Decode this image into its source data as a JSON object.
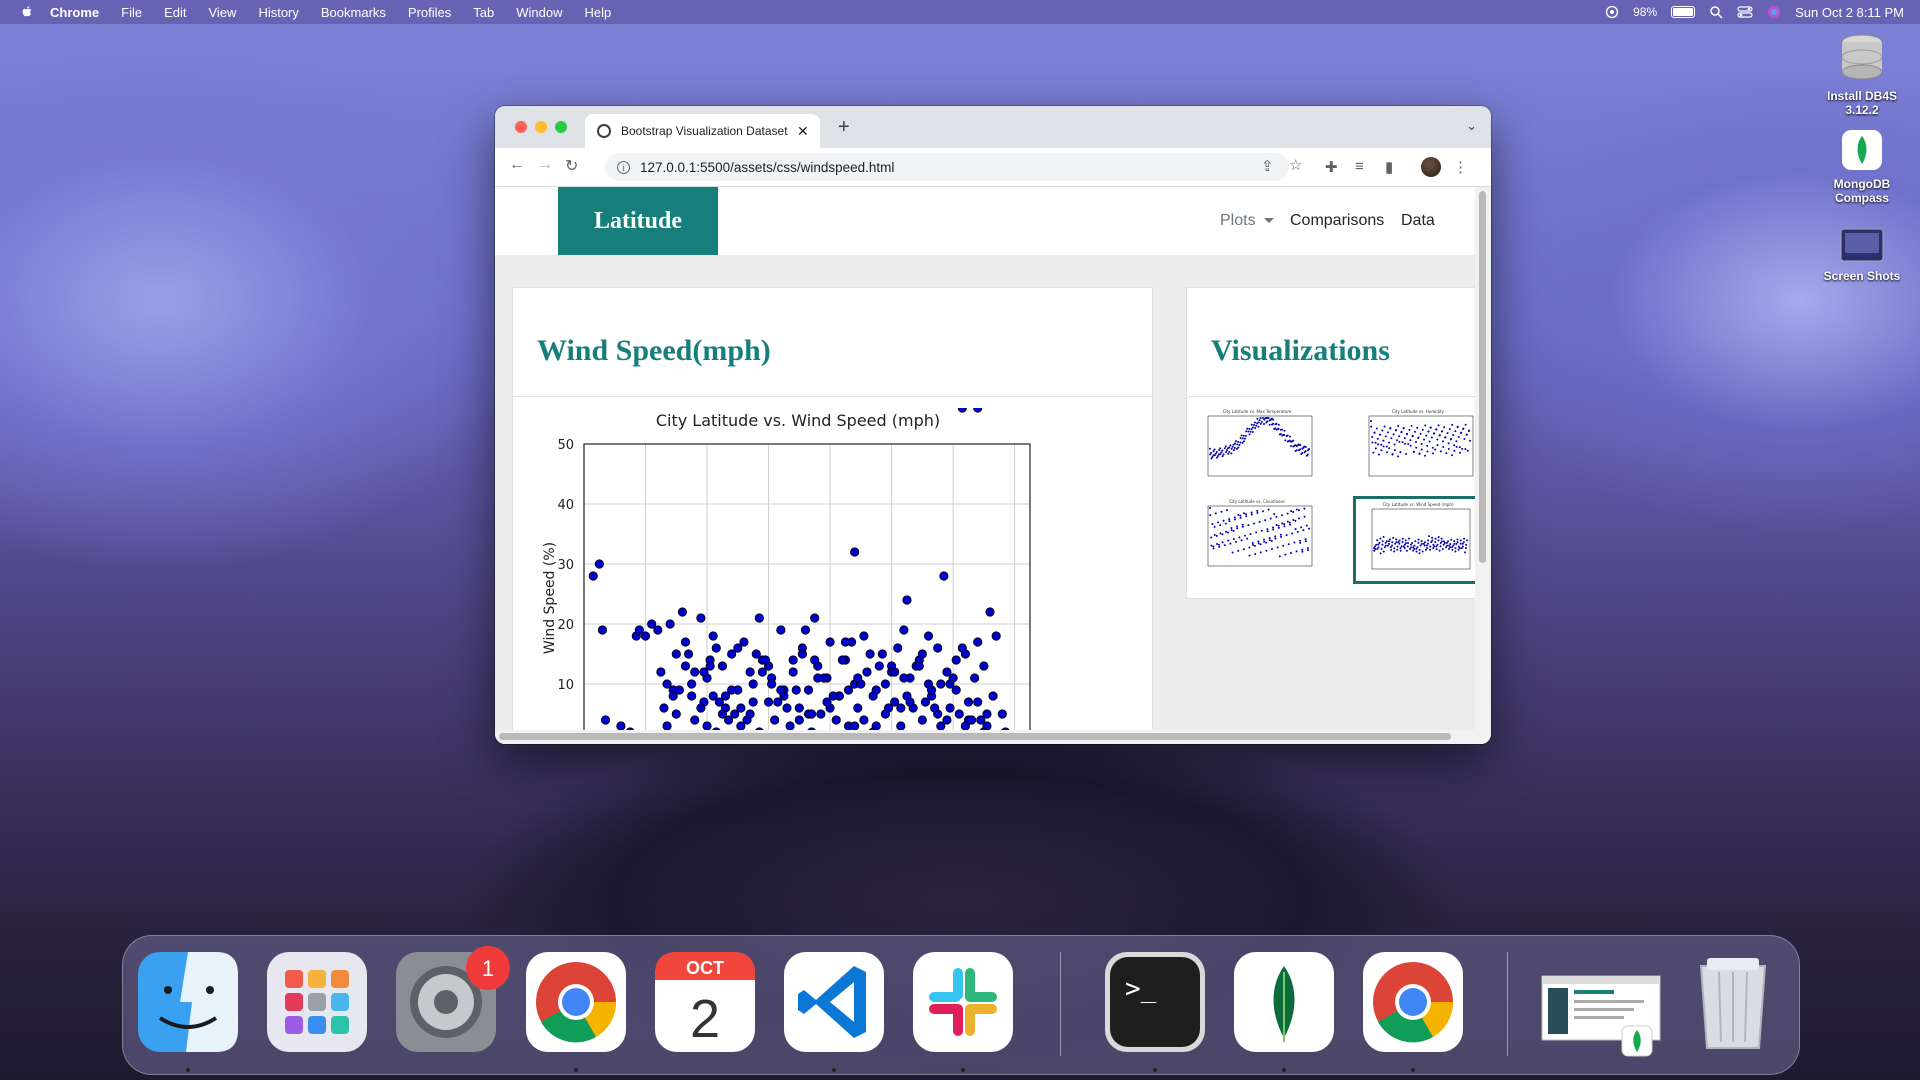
{
  "menubar": {
    "app": "Chrome",
    "items": [
      "File",
      "Edit",
      "View",
      "History",
      "Bookmarks",
      "Profiles",
      "Tab",
      "Window",
      "Help"
    ],
    "battery": "98%",
    "battery_level": 0.98,
    "datetime": "Sun Oct 2  8:11 PM"
  },
  "desktop": {
    "icons": [
      {
        "label": "Install DB4S 3.12.2",
        "icon": "disk-image-icon"
      },
      {
        "label": "MongoDB Compass",
        "icon": "mongodb-compass-icon"
      },
      {
        "label": "Screen Shots",
        "icon": "folder-icon"
      }
    ]
  },
  "browser": {
    "tab_title": "Bootstrap Visualization Dataset",
    "url": "127.0.0.1:5500/assets/css/windspeed.html"
  },
  "page": {
    "brand": "Latitude",
    "nav": {
      "plots": "Plots",
      "comparisons": "Comparisons",
      "data": "Data"
    },
    "main_card": {
      "title": "Wind Speed(mph)"
    },
    "side_card": {
      "title": "Visualizations"
    },
    "thumbnails": [
      {
        "caption": "City Latitude vs. Max Temperature"
      },
      {
        "caption": "City Latitude vs. Humidity"
      },
      {
        "caption": "City Latitude vs. Cloudiness"
      },
      {
        "caption": "City Latitude vs. Wind Speed (mph)"
      }
    ]
  },
  "chart_data": {
    "type": "scatter",
    "title": "City Latitude vs. Wind Speed (mph)",
    "ylabel": "Wind Speed (%)",
    "yticks": [
      10,
      20,
      30,
      40,
      50
    ],
    "ylim": [
      0,
      50
    ],
    "xlim": [
      -60,
      85
    ],
    "grid": true,
    "marker_color": "#0000cc",
    "x": [
      -57,
      -55,
      -54,
      -53,
      -48,
      -45,
      -43,
      -42,
      -40,
      -38,
      -36,
      -34,
      -33,
      -31,
      -30,
      -28,
      -27,
      -25,
      -24,
      -22,
      -21,
      -20,
      -19,
      -18,
      -17,
      -15,
      -14,
      -13,
      -12,
      -10,
      -9,
      -8,
      -6,
      -5,
      -3,
      -2,
      0,
      1,
      2,
      4,
      5,
      7,
      8,
      10,
      11,
      13,
      14,
      16,
      17,
      19,
      20,
      22,
      23,
      25,
      26,
      28,
      29,
      31,
      32,
      34,
      35,
      37,
      38,
      40,
      41,
      43,
      44,
      46,
      47,
      49,
      50,
      52,
      53,
      55,
      56,
      58,
      59,
      61,
      62,
      64,
      65,
      67,
      68,
      70,
      71,
      73,
      74,
      76,
      77,
      -35,
      -30,
      -25,
      -20,
      -15,
      -10,
      -5,
      0,
      5,
      10,
      15,
      20,
      25,
      30,
      35,
      40,
      45,
      50,
      55,
      60,
      65,
      70,
      -33,
      -27,
      -22,
      -17,
      -12,
      -7,
      -2,
      3,
      8,
      13,
      18,
      23,
      28,
      33,
      38,
      43,
      48,
      53,
      58,
      63,
      68,
      -31,
      -21,
      -11,
      -1,
      9,
      19,
      29,
      39,
      49,
      59,
      69,
      -26,
      -16,
      -6,
      4,
      14,
      24,
      34,
      44,
      54,
      64,
      -29,
      -19,
      -9,
      1,
      11,
      21,
      31,
      41,
      51,
      61,
      71,
      -24,
      -14,
      -4,
      6,
      16,
      26,
      36,
      46,
      56,
      66,
      -32,
      -18,
      -3,
      12,
      27,
      42,
      57,
      72,
      15,
      28,
      45,
      52,
      63,
      68
    ],
    "y": [
      28,
      30,
      19,
      4,
      3,
      2,
      18,
      19,
      18,
      20,
      19,
      6,
      3,
      9,
      5,
      22,
      17,
      10,
      4,
      21,
      7,
      3,
      14,
      8,
      2,
      13,
      6,
      4,
      15,
      9,
      3,
      17,
      5,
      10,
      2,
      14,
      7,
      11,
      4,
      19,
      8,
      3,
      12,
      6,
      16,
      9,
      2,
      13,
      5,
      11,
      17,
      4,
      8,
      14,
      3,
      10,
      6,
      18,
      12,
      2,
      9,
      15,
      5,
      13,
      7,
      3,
      19,
      11,
      6,
      14,
      4,
      10,
      8,
      16,
      3,
      12,
      6,
      9,
      5,
      15,
      4,
      11,
      7,
      13,
      3,
      8,
      18,
      5,
      2,
      12,
      15,
      8,
      11,
      5,
      16,
      7,
      13,
      9,
      4,
      14,
      6,
      17,
      10,
      3,
      12,
      8,
      15,
      5,
      11,
      7,
      2,
      10,
      13,
      6,
      16,
      9,
      4,
      12,
      7,
      14,
      5,
      11,
      8,
      3,
      15,
      10,
      6,
      13,
      9,
      4,
      16,
      17,
      8,
      12,
      5,
      14,
      9,
      7,
      11,
      6,
      13,
      10,
      4,
      15,
      7,
      12,
      9,
      5,
      14,
      8,
      11,
      6,
      3,
      9,
      13,
      6,
      10,
      15,
      8,
      4,
      12,
      7,
      14,
      5,
      12,
      8,
      15,
      6,
      11,
      9,
      13,
      7,
      10,
      4,
      20,
      18,
      21,
      19,
      17,
      16,
      28,
      22,
      21,
      32,
      24,
      18
    ]
  }
}
